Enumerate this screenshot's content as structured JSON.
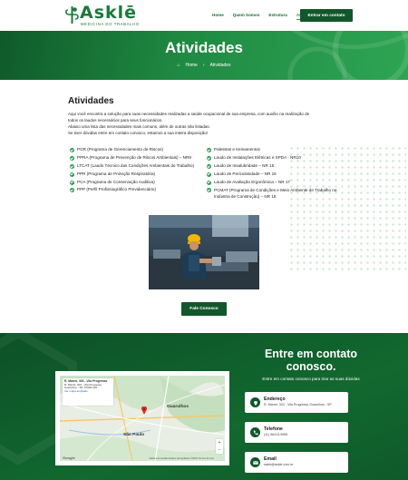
{
  "header": {
    "logo_text": "Asklē",
    "logo_sub": "MEDICINA DO TRABALHO",
    "nav": [
      "Home",
      "Quem Somos",
      "Estrutura",
      "Atividades"
    ],
    "cta": "Entrar em contato"
  },
  "hero": {
    "title": "Atividades",
    "crumb_home": "Home",
    "crumb_sep": "›",
    "crumb_current": "Atividades"
  },
  "content": {
    "title": "Atividades",
    "intro": [
      "Aqui você encontra a solução para suas necessidades realizadas a saúde ocupacional de sua empresa, com auxílio na realização de",
      "todos os laudos necessários para seus funcionários.",
      "Abaixo uma lista das necessidades mais comuns, além de outras não listadas.",
      "Se tiver dúvidas entre em contato conosco, estamos a sua inteira disposição!"
    ],
    "list_left": [
      "PGR (Programa de Gerenciamento de Riscos)",
      "PPRA (Programa de Prevenção de Riscos Ambientais) – NR9",
      "LTCAT (Laudo Técnico das Condições Ambientais do Trabalho)",
      "PPR (Programa de Proteção Respiratória)",
      "PCA (Programa de Conservação Auditiva)",
      "PPP (Perfil Profissiográfico Previdenciário)"
    ],
    "list_right": [
      "Palestras e treinamentos",
      "Laudo de Instalações Elétricas e SPDA - NR10",
      "Laudo de Insalubridade – NR 15",
      "Laudo de Periculosidade – NR 16",
      "Laudo de Avaliação Ergonômica – NR 17",
      "PCMAT (Programa de Condições e Meio Ambiente de Trabalho na Indústria de Construção) – NR 18"
    ],
    "cta": "Fale Conosco"
  },
  "contact": {
    "title": "Entre em contato conosco.",
    "subtitle": "Entre em contato conosco para tirar as suas dúvidas",
    "map": {
      "card_title": "R. Marrel, 303 - Vila Progresso",
      "card_addr": "R. Marrel, 303 - Vila Progresso Guarulhos - SP, 07094-120",
      "card_link": "Ver mapa ampliado",
      "label_guarulhos": "Guarulhos",
      "label_saopaulo": "São Paulo",
      "google": "Google",
      "credits": "Atalhos do teclado  Dados cartográficos ©2023  Termos de Uso",
      "zoom_in": "+",
      "zoom_out": "−"
    },
    "cards": [
      {
        "title": "Endereço",
        "value": "R. Marrel, 303 - Vila Progresso Guarulhos - SP"
      },
      {
        "title": "Telefone",
        "value": "(11) 96413-9955"
      },
      {
        "title": "Email",
        "value": "saktc@askle.com.br"
      }
    ]
  },
  "colors": {
    "brand_dark": "#12562b",
    "brand": "#1b7a3a",
    "accent": "#2e9a4f"
  }
}
